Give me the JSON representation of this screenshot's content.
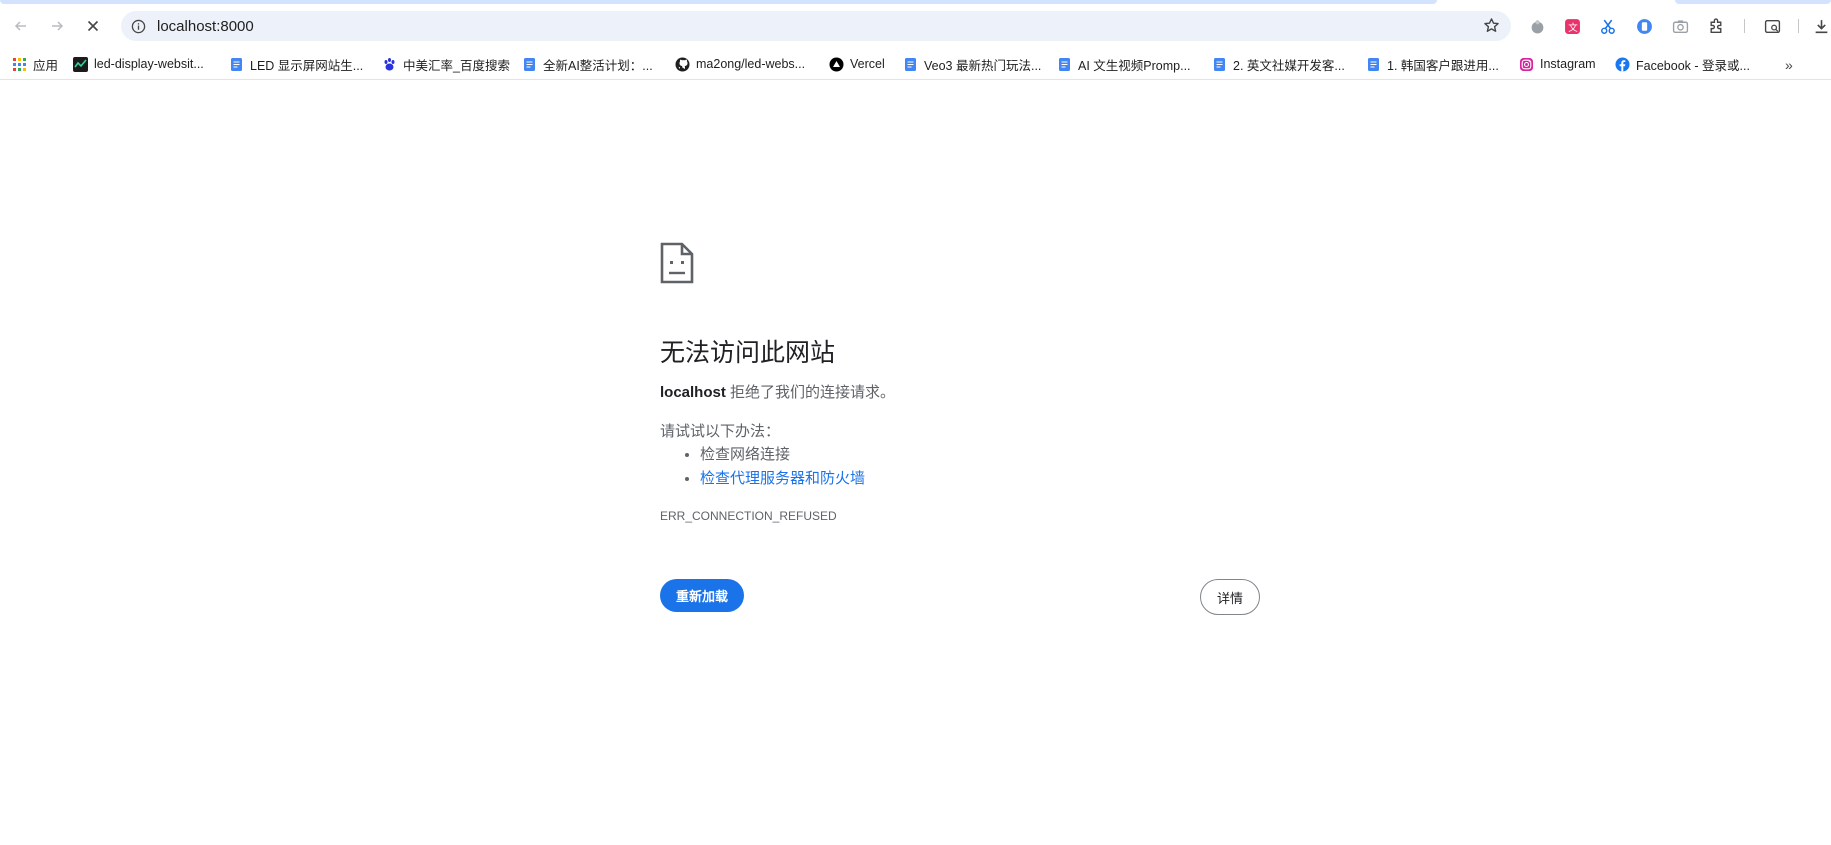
{
  "browser": {
    "url": "localhost:8000",
    "bookmarks": [
      {
        "label": "应用",
        "icon": "apps-grid-icon"
      },
      {
        "label": "led-display-websit...",
        "icon": "chart-favicon-icon"
      },
      {
        "label": "LED 显示屏网站生...",
        "icon": "doc-icon"
      },
      {
        "label": "中美汇率_百度搜索",
        "icon": "baidu-paw-icon"
      },
      {
        "label": "全新AI整活计划：...",
        "icon": "doc-icon"
      },
      {
        "label": "ma2ong/led-webs...",
        "icon": "github-icon"
      },
      {
        "label": "Vercel",
        "icon": "vercel-icon"
      },
      {
        "label": "Veo3 最新热门玩法...",
        "icon": "doc-icon"
      },
      {
        "label": "AI 文生视频Promp...",
        "icon": "doc-icon"
      },
      {
        "label": "2. 英文社媒开发客...",
        "icon": "doc-icon"
      },
      {
        "label": "1. 韩国客户跟进用...",
        "icon": "doc-icon"
      },
      {
        "label": "Instagram",
        "icon": "instagram-icon"
      },
      {
        "label": "Facebook - 登录或...",
        "icon": "facebook-icon"
      }
    ],
    "more_bookmarks": "»"
  },
  "error_page": {
    "title": "无法访问此网站",
    "host": "localhost",
    "message_suffix": " 拒绝了我们的连接请求。",
    "try_heading": "请试试以下办法：",
    "suggestions": [
      "检查网络连接",
      "检查代理服务器和防火墙"
    ],
    "error_code": "ERR_CONNECTION_REFUSED",
    "reload_label": "重新加载",
    "details_label": "详情"
  },
  "colors": {
    "accent": "#1a73e8",
    "omnibox_bg": "#edf2fa",
    "tab_highlight": "#d3e3fd"
  }
}
